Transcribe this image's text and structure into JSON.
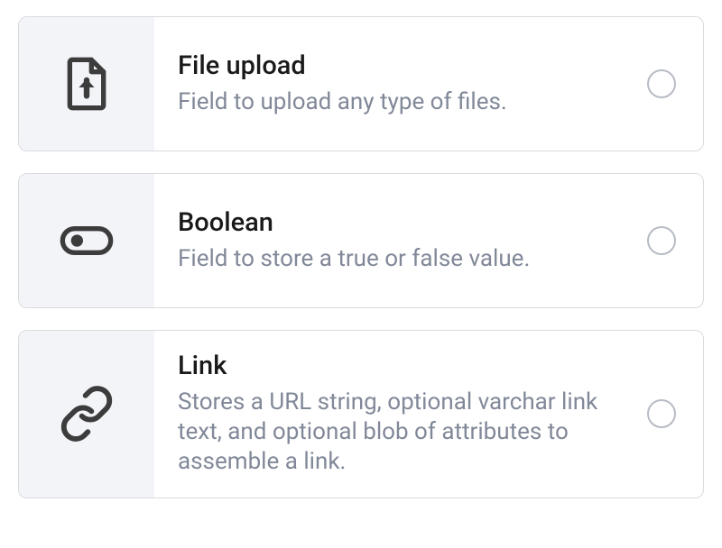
{
  "field_types": [
    {
      "icon": "file-upload",
      "title": "File upload",
      "description": "Field to upload any type of files.",
      "selected": false
    },
    {
      "icon": "toggle",
      "title": "Boolean",
      "description": "Field to store a true or false value.",
      "selected": false
    },
    {
      "icon": "link",
      "title": "Link",
      "description": "Stores a URL string, optional varchar link text, and optional blob of attrib­utes to assemble a link.",
      "selected": false
    }
  ]
}
